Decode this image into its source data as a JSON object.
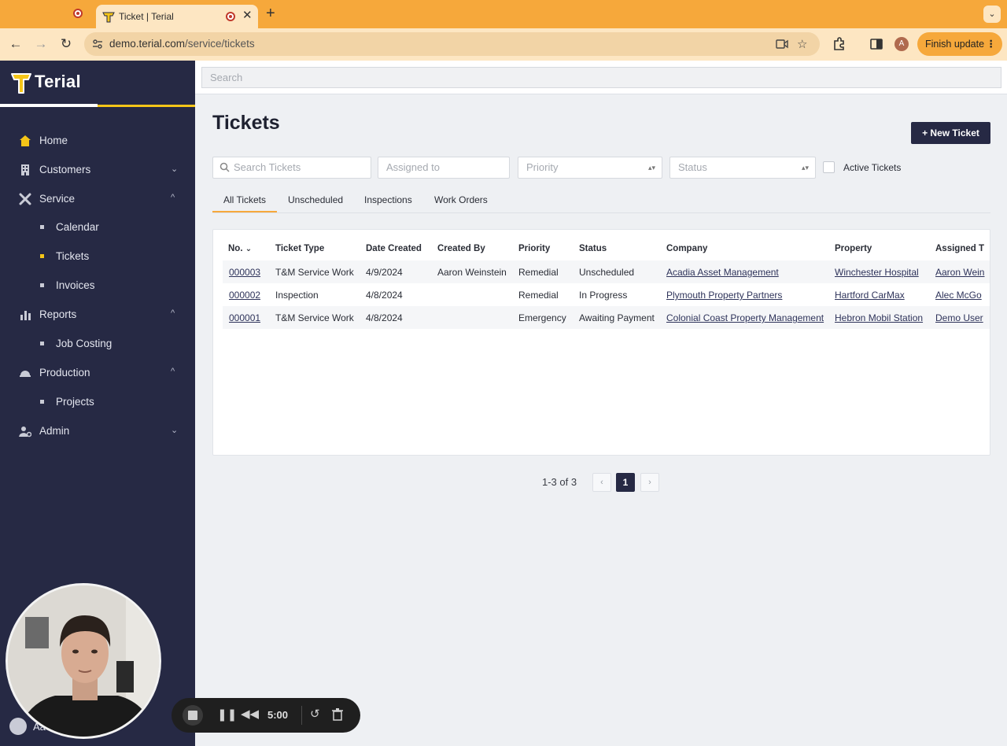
{
  "browser": {
    "tab_title": "Ticket | Terial",
    "url_domain": "demo.terial.com",
    "url_path": "/service/tickets",
    "finish_update_label": "Finish update",
    "profile_initial": "A"
  },
  "app": {
    "logo_text": "Terial",
    "global_search_placeholder": "Search"
  },
  "sidebar": {
    "items": [
      {
        "label": "Home",
        "icon": "home-icon"
      },
      {
        "label": "Customers",
        "icon": "building-icon"
      },
      {
        "label": "Service",
        "icon": "tools-icon"
      },
      {
        "label": "Calendar"
      },
      {
        "label": "Tickets"
      },
      {
        "label": "Invoices"
      },
      {
        "label": "Reports",
        "icon": "bar-chart-icon"
      },
      {
        "label": "Job Costing"
      },
      {
        "label": "Production",
        "icon": "hardhat-icon"
      },
      {
        "label": "Projects"
      },
      {
        "label": "Admin",
        "icon": "user-gear-icon"
      }
    ],
    "user_name": "Aa"
  },
  "page": {
    "title": "Tickets",
    "new_ticket_label": "+ New Ticket",
    "filters": {
      "search_placeholder": "Search Tickets",
      "assigned_placeholder": "Assigned to",
      "priority_placeholder": "Priority",
      "status_placeholder": "Status",
      "active_tickets_label": "Active Tickets"
    },
    "tabs": [
      "All Tickets",
      "Unscheduled",
      "Inspections",
      "Work Orders"
    ],
    "table": {
      "headers": [
        "No.",
        "Ticket Type",
        "Date Created",
        "Created By",
        "Priority",
        "Status",
        "Company",
        "Property",
        "Assigned T"
      ],
      "rows": [
        {
          "no": "000003",
          "type": "T&M Service Work",
          "date": "4/9/2024",
          "created_by": "Aaron Weinstein",
          "priority": "Remedial",
          "status": "Unscheduled",
          "company": "Acadia Asset Management",
          "property": "Winchester Hospital",
          "assigned": "Aaron Wein"
        },
        {
          "no": "000002",
          "type": "Inspection",
          "date": "4/8/2024",
          "created_by": "",
          "priority": "Remedial",
          "status": "In Progress",
          "company": "Plymouth Property Partners",
          "property": "Hartford CarMax",
          "assigned": "Alec McGo"
        },
        {
          "no": "000001",
          "type": "T&M Service Work",
          "date": "4/8/2024",
          "created_by": "",
          "priority": "Emergency",
          "status": "Awaiting Payment",
          "company": "Colonial Coast Property Management",
          "property": "Hebron Mobil Station",
          "assigned": "Demo User"
        }
      ]
    },
    "pagination": {
      "info": "1-3 of 3",
      "current": "1"
    }
  },
  "recorder": {
    "timer": "5:00"
  },
  "colors": {
    "sidebar_bg": "#262944",
    "accent_yellow": "#f5c518",
    "chrome_orange": "#f6a83b",
    "primary_button": "#262944"
  }
}
